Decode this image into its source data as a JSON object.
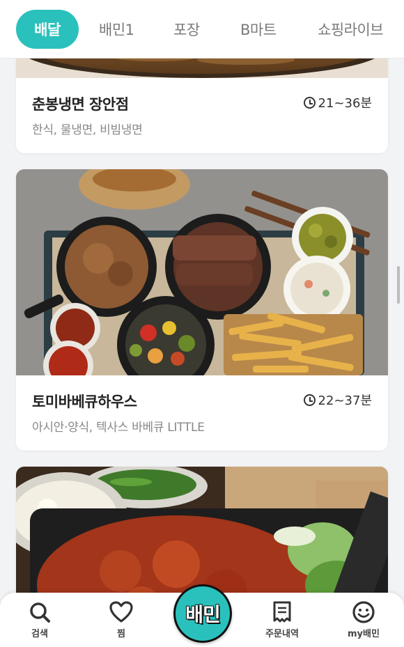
{
  "tabs": [
    {
      "label": "배달",
      "active": true
    },
    {
      "label": "배민1",
      "active": false
    },
    {
      "label": "포장",
      "active": false
    },
    {
      "label": "B마트",
      "active": false
    },
    {
      "label": "쇼핑라이브",
      "active": false
    }
  ],
  "stores": [
    {
      "name": "춘봉냉면 장안점",
      "time": "21~36분",
      "categories": "한식, 물냉면, 비빔냉면"
    },
    {
      "name": "토미바베큐하우스",
      "time": "22~37분",
      "categories": "아시안·양식, 텍사스 바베큐 LITTLE"
    }
  ],
  "bottom_nav": {
    "search": "검색",
    "favorites": "찜",
    "center": "배민",
    "orders": "주문내역",
    "my": "my배민"
  },
  "colors": {
    "accent": "#2ac1bc"
  }
}
